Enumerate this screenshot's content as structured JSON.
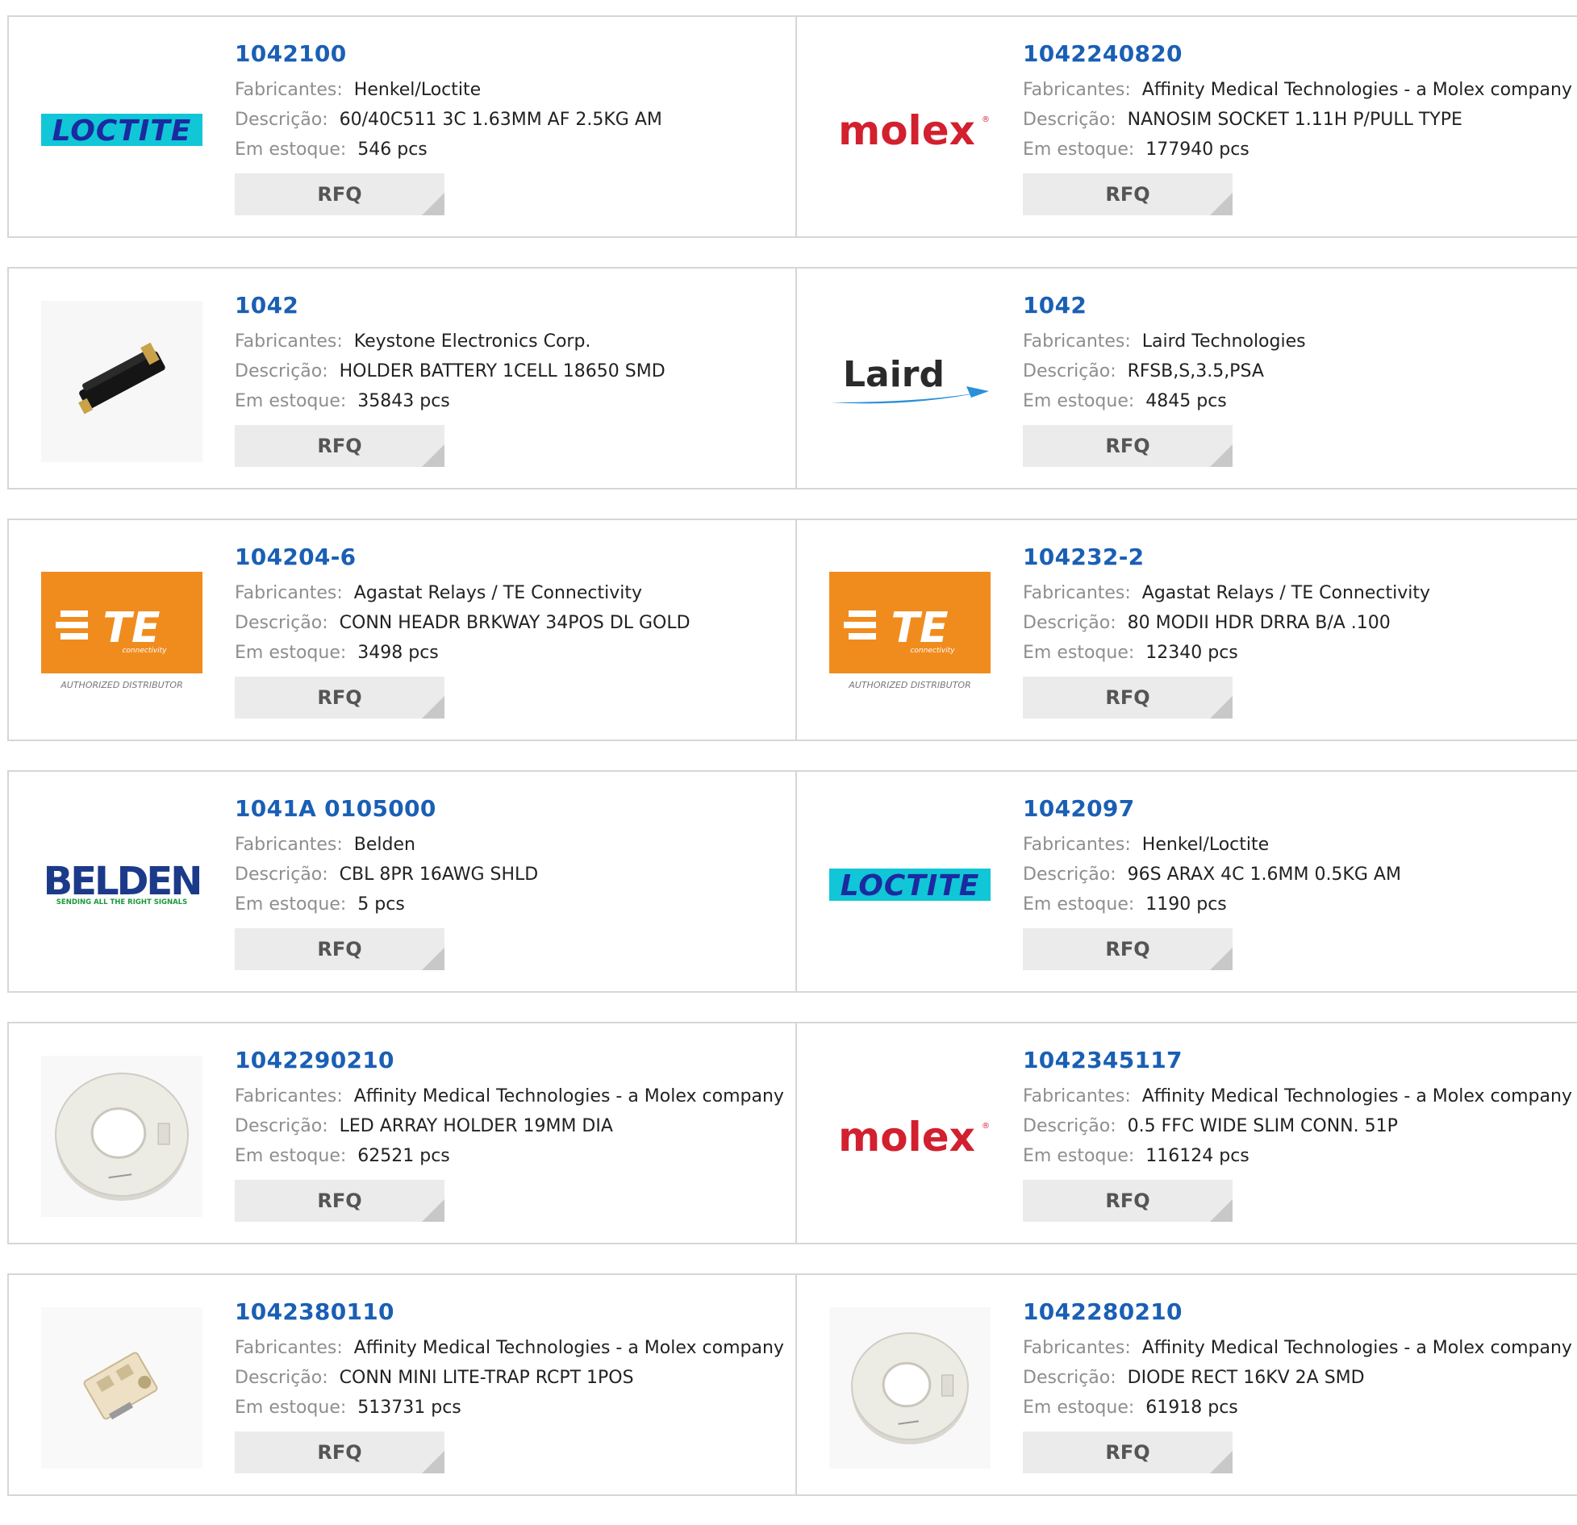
{
  "labels": {
    "manufacturer": "Fabricantes:",
    "description": "Descrição:",
    "stock": "Em estoque:",
    "rfq": "RFQ"
  },
  "logos": {
    "loctite": {
      "text": "LOCTITE",
      "bg": "#11c6d6",
      "fg": "#1b2aa0"
    },
    "molex": {
      "text": "molex",
      "color": "#d2202f",
      "mark": "®"
    },
    "laird": {
      "text": "Laird",
      "swoosh": "#2a8fd9"
    },
    "te": {
      "text": "TE",
      "sub": "connectivity",
      "caption": "AUTHORIZED DISTRIBUTOR",
      "bg": "#f08c1e"
    },
    "belden": {
      "text": "BELDEN",
      "tagline": "SENDING ALL THE RIGHT SIGNALS",
      "color": "#1b3a8a",
      "tag_color": "#1a9a3a"
    }
  },
  "products": [
    {
      "part": "1042100",
      "manufacturer": "Henkel/Loctite",
      "description": "60/40C511 3C 1.63MM AF 2.5KG AM",
      "stock": "546 pcs",
      "image": "loctite"
    },
    {
      "part": "1042240820",
      "manufacturer": "Affinity Medical Technologies - a Molex company",
      "description": "NANOSIM SOCKET 1.11H P/PULL TYPE",
      "stock": "177940 pcs",
      "image": "molex"
    },
    {
      "part": "1042",
      "manufacturer": "Keystone Electronics Corp.",
      "description": "HOLDER BATTERY 1CELL 18650 SMD",
      "stock": "35843 pcs",
      "image": "battery-holder"
    },
    {
      "part": "1042",
      "manufacturer": "Laird Technologies",
      "description": "RFSB,S,3.5,PSA",
      "stock": "4845 pcs",
      "image": "laird"
    },
    {
      "part": "104204-6",
      "manufacturer": "Agastat Relays / TE Connectivity",
      "description": "CONN HEADR BRKWAY 34POS DL GOLD",
      "stock": "3498 pcs",
      "image": "te"
    },
    {
      "part": "104232-2",
      "manufacturer": "Agastat Relays / TE Connectivity",
      "description": "80 MODII HDR DRRA B/A .100",
      "stock": "12340 pcs",
      "image": "te"
    },
    {
      "part": "1041A 0105000",
      "manufacturer": "Belden",
      "description": "CBL 8PR 16AWG SHLD",
      "stock": "5 pcs",
      "image": "belden"
    },
    {
      "part": "1042097",
      "manufacturer": "Henkel/Loctite",
      "description": "96S ARAX 4C 1.6MM 0.5KG AM",
      "stock": "1190 pcs",
      "image": "loctite"
    },
    {
      "part": "1042290210",
      "manufacturer": "Affinity Medical Technologies - a Molex company",
      "description": "LED ARRAY HOLDER 19MM DIA",
      "stock": "62521 pcs",
      "image": "led-holder"
    },
    {
      "part": "1042345117",
      "manufacturer": "Affinity Medical Technologies - a Molex company",
      "description": "0.5 FFC WIDE SLIM CONN. 51P",
      "stock": "116124 pcs",
      "image": "molex"
    },
    {
      "part": "1042380110",
      "manufacturer": "Affinity Medical Technologies - a Molex company",
      "description": "CONN MINI LITE-TRAP RCPT 1POS",
      "stock": "513731 pcs",
      "image": "connector"
    },
    {
      "part": "1042280210",
      "manufacturer": "Affinity Medical Technologies - a Molex company",
      "description": "DIODE RECT 16KV 2A SMD",
      "stock": "61918 pcs",
      "image": "led-holder-small"
    }
  ]
}
